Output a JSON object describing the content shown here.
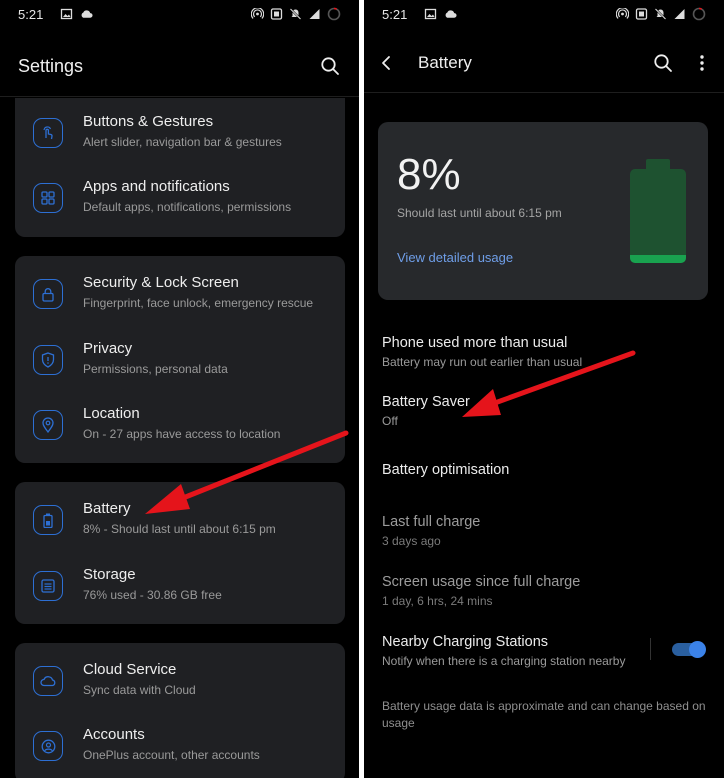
{
  "status_bar": {
    "time": "5:21"
  },
  "settings": {
    "title": "Settings",
    "groups": [
      {
        "items": [
          {
            "title": "Buttons & Gestures",
            "subtitle": "Alert slider, navigation bar & gestures",
            "icon": "gesture-icon"
          },
          {
            "title": "Apps and notifications",
            "subtitle": "Default apps, notifications, permissions",
            "icon": "apps-grid-icon"
          }
        ]
      },
      {
        "items": [
          {
            "title": "Security & Lock Screen",
            "subtitle": "Fingerprint, face unlock, emergency rescue",
            "icon": "lock-icon"
          },
          {
            "title": "Privacy",
            "subtitle": "Permissions, personal data",
            "icon": "shield-icon"
          },
          {
            "title": "Location",
            "subtitle": "On - 27 apps have access to location",
            "icon": "location-pin-icon"
          }
        ]
      },
      {
        "items": [
          {
            "title": "Battery",
            "subtitle": "8% - Should last until about 6:15 pm",
            "icon": "battery-icon"
          },
          {
            "title": "Storage",
            "subtitle": "76% used - 30.86 GB free",
            "icon": "storage-icon"
          }
        ]
      },
      {
        "items": [
          {
            "title": "Cloud Service",
            "subtitle": "Sync data with Cloud",
            "icon": "cloud-icon"
          },
          {
            "title": "Accounts",
            "subtitle": "OnePlus account, other accounts",
            "icon": "account-icon"
          }
        ]
      }
    ]
  },
  "battery": {
    "title": "Battery",
    "percent": "8%",
    "level_fraction": 0.08,
    "estimate": "Should last until about 6:15 pm",
    "detail_link": "View detailed usage",
    "rows": [
      {
        "title": "Phone used more than usual",
        "subtitle": "Battery may run out earlier than usual"
      },
      {
        "title": "Battery Saver",
        "subtitle": "Off"
      },
      {
        "title": "Battery optimisation",
        "subtitle": ""
      },
      {
        "title": "Last full charge",
        "subtitle": "3 days ago"
      },
      {
        "title": "Screen usage since full charge",
        "subtitle": "1 day, 6 hrs, 24 mins"
      },
      {
        "title": "Nearby Charging Stations",
        "subtitle": "Notify when there is a charging station nearby"
      }
    ],
    "nearby_toggle_on": true,
    "footnote": "Battery usage data is approximate and can change based on usage"
  },
  "colors": {
    "accent_blue": "#2d6fd3",
    "battery_green": "#19a24f",
    "arrow_red": "#e5141b",
    "card_bg": "#1f2023",
    "link_blue": "#6f9ee8"
  }
}
